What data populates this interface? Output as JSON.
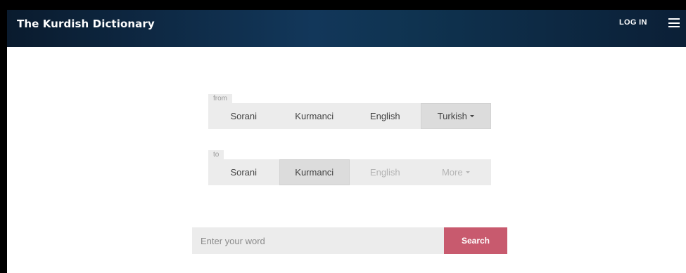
{
  "header": {
    "brand": "The Kurdish Dictionary",
    "login": "LOG IN",
    "menu_icon": "hamburger-menu-icon"
  },
  "from": {
    "label": "from",
    "options": [
      {
        "label": "Sorani",
        "state": "normal"
      },
      {
        "label": "Kurmanci",
        "state": "normal"
      },
      {
        "label": "English",
        "state": "normal"
      },
      {
        "label": "Turkish",
        "state": "selected",
        "dropdown": true
      }
    ]
  },
  "to": {
    "label": "to",
    "options": [
      {
        "label": "Sorani",
        "state": "normal"
      },
      {
        "label": "Kurmanci",
        "state": "selected"
      },
      {
        "label": "English",
        "state": "disabled"
      },
      {
        "label": "More",
        "state": "disabled",
        "dropdown": true
      }
    ]
  },
  "search": {
    "placeholder": "Enter your word",
    "value": "",
    "button": "Search"
  },
  "colors": {
    "header_bg": "#12375a",
    "search_button": "#c85a6e",
    "toggle_bg": "#ececec",
    "toggle_active": "#dcdcdc"
  }
}
